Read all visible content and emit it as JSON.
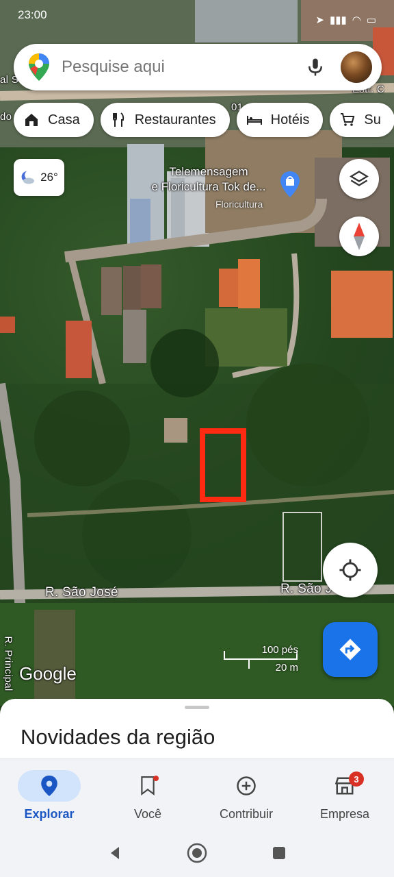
{
  "status_bar": {
    "time": "23:00"
  },
  "search": {
    "placeholder": "Pesquise aqui"
  },
  "chips": [
    {
      "label": "Casa",
      "icon": "home-icon"
    },
    {
      "label": "Restaurantes",
      "icon": "fork-knife-icon"
    },
    {
      "label": "Hotéis",
      "icon": "bed-icon"
    },
    {
      "label": "Su",
      "icon": "cart-icon"
    }
  ],
  "weather": {
    "temperature": "26°",
    "icon": "partly-cloudy-night-icon"
  },
  "map": {
    "poi": {
      "name_line1": "Telemensagem",
      "name_line2": "e Floricultura Tok de...",
      "category": "Floricultura"
    },
    "street_labels": {
      "estr_top": "Estr. C",
      "road_top_left": "al S",
      "road_left_2": "do",
      "road_number": "01",
      "rua_sao_jose_1": "R. São José",
      "rua_sao_jose_2": "R. São J",
      "rua_principal": "R. Principal"
    },
    "scale": {
      "imperial": "100 pés",
      "metric": "20 m"
    },
    "attribution": "Google",
    "highlight_color": "#ff2a12"
  },
  "sheet": {
    "title": "Novidades da região"
  },
  "nav": {
    "items": [
      {
        "label": "Explorar",
        "icon": "location-pin-icon",
        "active": true
      },
      {
        "label": "Você",
        "icon": "bookmark-icon",
        "active": false
      },
      {
        "label": "Contribuir",
        "icon": "add-circle-icon",
        "active": false
      },
      {
        "label": "Empresa",
        "icon": "store-icon",
        "active": false,
        "badge": "3"
      }
    ]
  },
  "colors": {
    "accent": "#1a73e8",
    "active_nav_bg": "#d2e3fc",
    "badge": "#d93025"
  }
}
